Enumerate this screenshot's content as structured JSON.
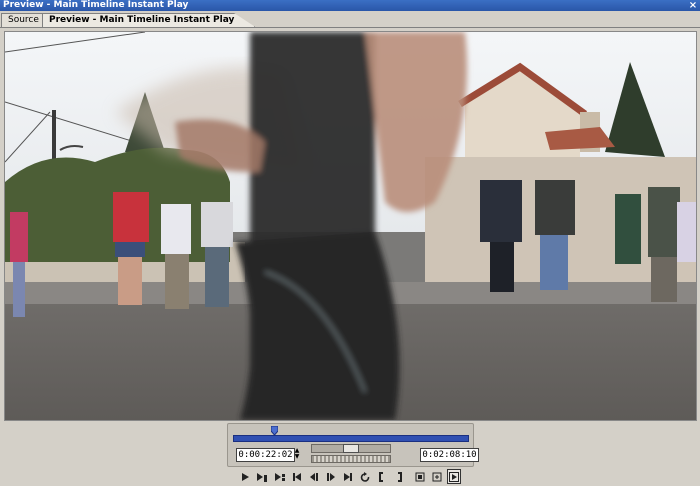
{
  "window": {
    "title": "Preview - Main Timeline Instant Play",
    "close_glyph": "×"
  },
  "tabs": [
    {
      "label": "Source",
      "active": false
    },
    {
      "label": "Preview - Main Timeline Instant Play",
      "active": true
    }
  ],
  "viewer": {
    "content": "video frame"
  },
  "controls": {
    "current_timecode": "0:00:22:02",
    "duration_timecode": "0:02:08:10"
  },
  "transport": {
    "buttons": [
      {
        "name": "play-icon"
      },
      {
        "name": "play-in-to-out-icon"
      },
      {
        "name": "play-around-icon"
      },
      {
        "name": "go-to-start-icon"
      },
      {
        "name": "step-back-icon"
      },
      {
        "name": "step-forward-icon"
      },
      {
        "name": "go-to-end-icon"
      },
      {
        "name": "loop-icon"
      },
      {
        "name": "mark-in-icon"
      },
      {
        "name": "mark-out-icon"
      },
      {
        "name": "export-frame-icon"
      },
      {
        "name": "safe-margins-icon"
      },
      {
        "name": "output-icon"
      }
    ]
  },
  "colors": {
    "title_bar": "#2a56a8",
    "scrubber": "#2f4fb2"
  }
}
